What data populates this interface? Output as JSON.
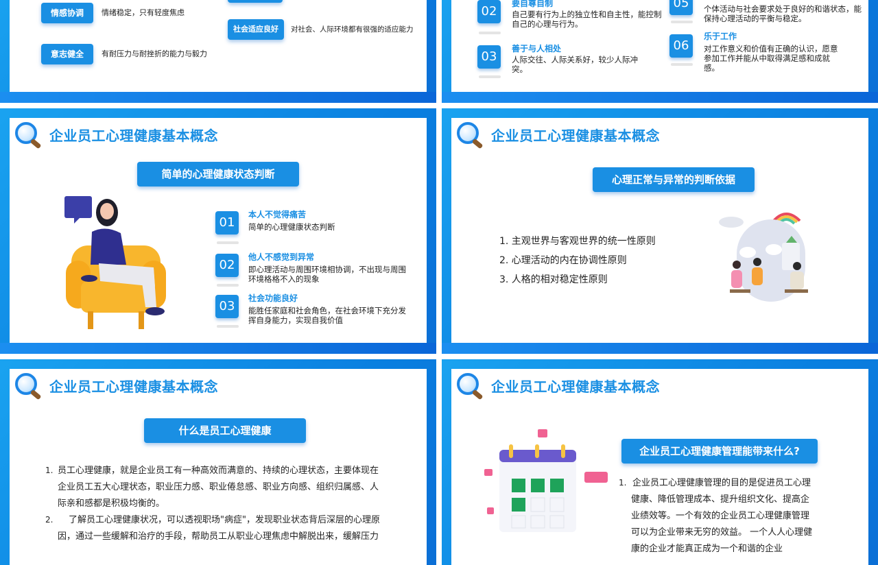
{
  "slide_top_left": {
    "tags": [
      {
        "label": "情感协调",
        "desc": "情绪稳定，只有轻度焦虑"
      },
      {
        "label": "意志健全",
        "desc": "有耐压力与耐挫折的能力与毅力"
      },
      {
        "label": "社会适应良好",
        "desc": "对社会、人际环境都有很强的适应能力"
      }
    ]
  },
  "slide_top_right": {
    "items": [
      {
        "num": "02",
        "title": "要自尊自制",
        "text": "自己要有行为上的独立性和自主性，能控制自己的心理与行为。"
      },
      {
        "num": "03",
        "title": "善于与人相处",
        "text": "人际交往、人际关系好，较少人际冲突。"
      },
      {
        "num": "05",
        "title": "",
        "text": "个体活动与社会要求处于良好的和谐状态，能保持心理活动的平衡与稳定。"
      },
      {
        "num": "06",
        "title": "乐于工作",
        "text": "对工作意义和价值有正确的认识，愿意参加工作并能从中取得满足感和成就感。"
      }
    ]
  },
  "slide_mid_left": {
    "title": "企业员工心理健康基本概念",
    "subtitle": "简单的心理健康状态判断",
    "items": [
      {
        "num": "01",
        "title": "本人不觉得痛苦",
        "text": "简单的心理健康状态判断"
      },
      {
        "num": "02",
        "title": "他人不感觉到异常",
        "text": "即心理活动与周围环境相协调，不出现与周围环境格格不入的现象"
      },
      {
        "num": "03",
        "title": "社会功能良好",
        "text": "能胜任家庭和社会角色，在社会环境下充分发挥自身能力，实现自我价值"
      }
    ]
  },
  "slide_mid_right": {
    "title": "企业员工心理健康基本概念",
    "subtitle": "心理正常与异常的判断依据",
    "list": [
      "1. 主观世界与客观世界的统一性原则",
      "2. 心理活动的内在协调性原则",
      "3. 人格的相对稳定性原则"
    ]
  },
  "slide_bot_left": {
    "title": "企业员工心理健康基本概念",
    "subtitle": "什么是员工心理健康",
    "p1_num": "1.",
    "p1_lines": [
      "员工心理健康，就是企业员工有一种高效而满意的、持续的心理状态，主要体现在",
      "企业员工五大心理状态，职业压力感、职业倦怠感、职业方向感、组织归属感、人",
      "际亲和感都是积极均衡的。"
    ],
    "p2_num": "2.",
    "p2_lines": [
      "了解员工心理健康状况，可以透视职场\"病症\"，发现职业状态背后深层的心理原",
      "因，通过一些缓解和治疗的手段，帮助员工从职业心理焦虑中解脱出来，缓解压力"
    ]
  },
  "slide_bot_right": {
    "title": "企业员工心理健康基本概念",
    "subtitle": "企业员工心理健康管理能带来什么?",
    "p_num": "1.",
    "p_lines": [
      "企业员工心理健康管理的目的是促进员工心理",
      "健康、降低管理成本、提升组织文化、提高企",
      "业绩效等。一个有效的企业员工心理健康管理",
      "可以为企业带来无穷的效益。 一个人人心理健",
      "康的企业才能真正成为一个和谐的企业"
    ]
  },
  "colors": {
    "accent": "#1a8fe3",
    "frame": "#0a7fe0"
  }
}
